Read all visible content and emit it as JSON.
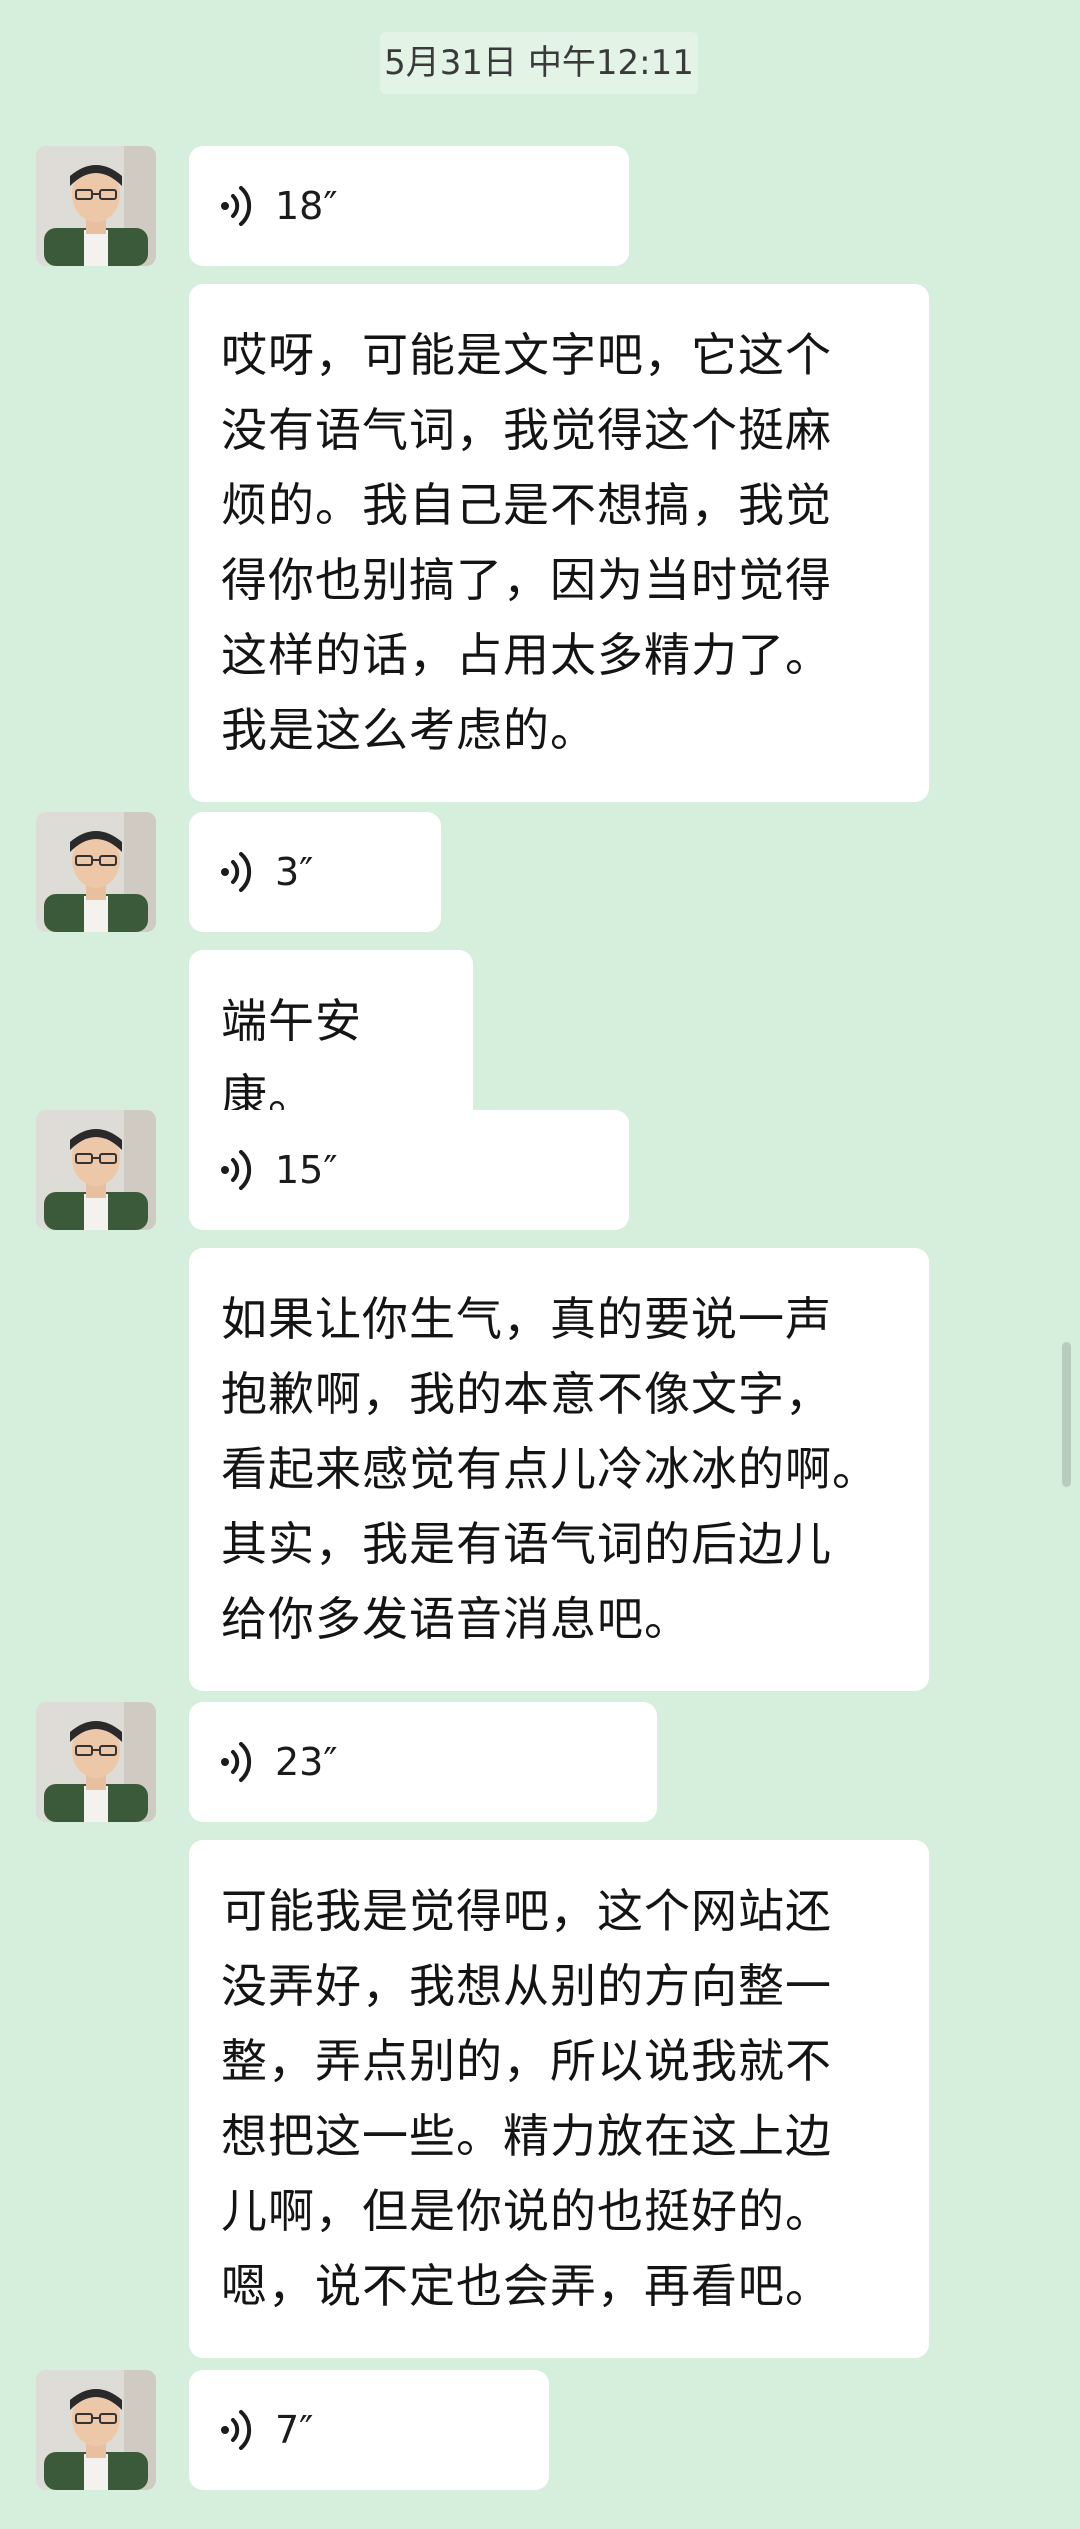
{
  "header": {
    "timestamp": "5月31日 中午12:11"
  },
  "messages": [
    {
      "duration": "18″",
      "transcript": "哎呀，可能是文字吧，它这个\n没有语气词，我觉得这个挺麻\n烦的。我自己是不想搞，我觉\n得你也别搞了，因为当时觉得\n这样的话，占用太多精力了。\n我是这么考虑的。"
    },
    {
      "duration": "3″",
      "transcript": "端午安康。"
    },
    {
      "duration": "15″",
      "transcript": "如果让你生气，真的要说一声\n抱歉啊，我的本意不像文字，\n看起来感觉有点儿冷冰冰的啊。\n其实，我是有语气词的后边儿\n给你多发语音消息吧。"
    },
    {
      "duration": "23″",
      "transcript": "可能我是觉得吧，这个网站还\n没弄好，我想从别的方向整一\n整，弄点别的，所以说我就不\n想把这一些。精力放在这上边\n儿啊，但是你说的也挺好的。\n嗯，说不定也会弄，再看吧。"
    },
    {
      "duration": "7″"
    }
  ],
  "icons": {
    "avatar": "avatar-photo",
    "voice": "voice-wave-icon"
  }
}
